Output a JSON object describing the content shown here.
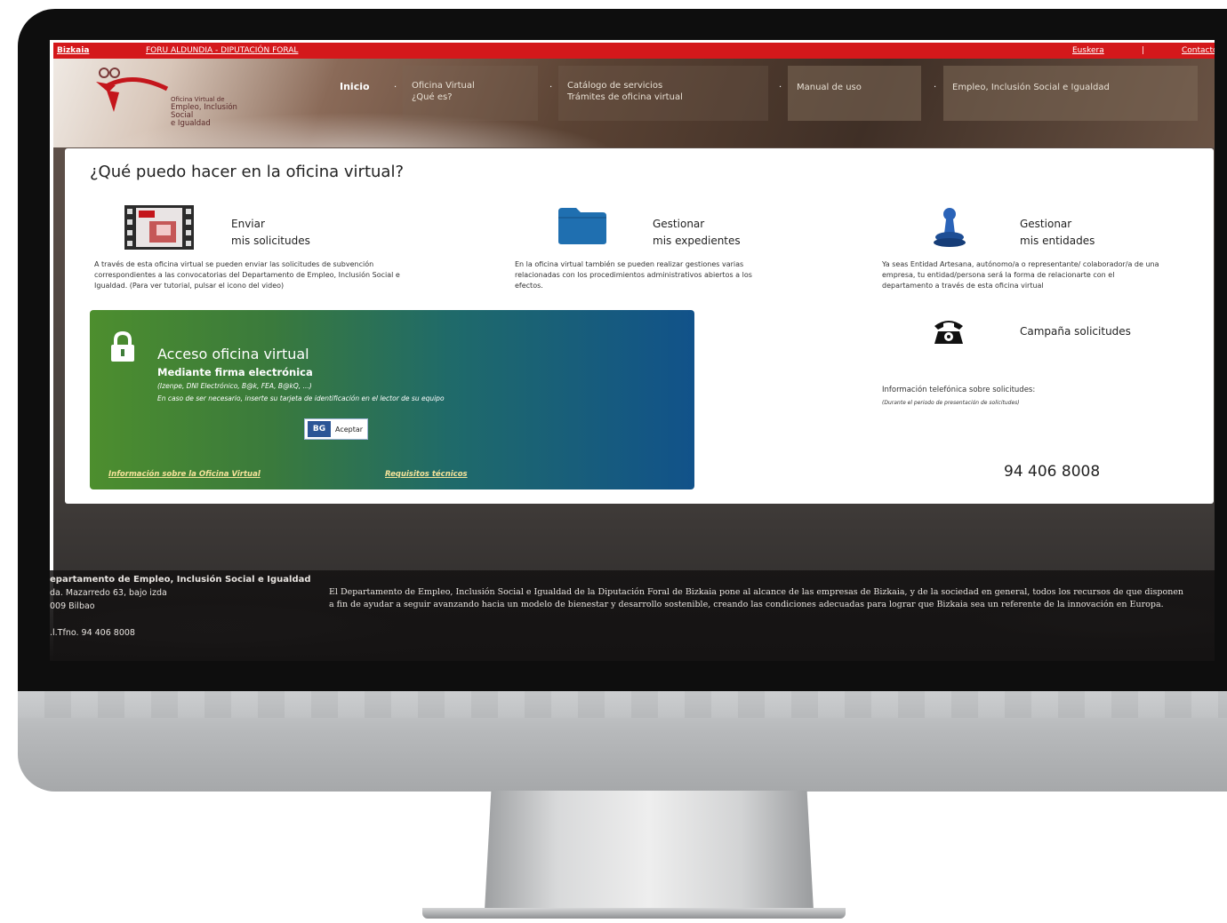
{
  "topbar": {
    "bizkaia": "Bizkaia",
    "foru": "FORU ALDUNDIA - DIPUTACIÓN FORAL",
    "euskera": "Euskera",
    "separator": "|",
    "contact": "Contacto"
  },
  "header": {
    "logo_line1": "Oficina Virtual de",
    "logo_line2": "Empleo, Inclusión Social\ne Igualdad",
    "nav": {
      "inicio": "Inicio",
      "oficina": "Oficina Virtual\n¿Qué es?",
      "catalogo": "Catálogo de servicios\nTrámites de oficina virtual",
      "manual": "Manual de uso",
      "empleo": "Empleo, Inclusión Social e Igualdad"
    }
  },
  "main": {
    "title": "¿Qué puedo hacer en la oficina virtual?",
    "features": [
      {
        "title": "Enviar\nmis solicitudes",
        "description": "A través de esta oficina virtual se pueden enviar las solicitudes de subvención\ncorrespondientes a las convocatorias del Departamento de Empleo, Inclusión Social e\nIgualdad. (Para ver tutorial, pulsar el icono del video)"
      },
      {
        "title": "Gestionar\nmis expedientes",
        "description": "En la oficina virtual también se pueden realizar gestiones varias\nrelacionadas con los procedimientos administrativos abiertos a los\nefectos."
      },
      {
        "title": "Gestionar\nmis entidades",
        "description": "Ya seas Entidad Artesana, autónomo/a o representante/ colaborador/a de una\nempresa, tu entidad/persona será la forma de relacionarte con el\ndepartamento a través de esta oficina virtual"
      }
    ],
    "campaign": {
      "title": "Campaña solicitudes",
      "info": "Información telefónica sobre solicitudes:",
      "note": "(Durante el periodo de presentación de solicitudes)",
      "phone": "94 406 8008"
    },
    "access": {
      "title": "Acceso oficina virtual",
      "subtitle": "Mediante firma electrónica",
      "note1": "(Izenpe, DNI Electrónico, B@k, FEA, B@kQ, ...)",
      "note2": "En caso de ser necesario, inserte su tarjeta de identificación en el lector de su equipo",
      "button_badge": "BG",
      "button_label": "Aceptar",
      "link_info": "Información sobre la Oficina Virtual",
      "link_req": "Requisitos técnicos"
    }
  },
  "footer": {
    "dept": "epartamento de Empleo, Inclusión Social e Igualdad",
    "address": "da. Mazarredo 63, bajo izda\n009 Bilbao",
    "phone": ".l.Tfno. 94 406 8008",
    "text": "El Departamento de Empleo, Inclusión Social e Igualdad de la Diputación Foral de Bizkaia pone al alcance de las empresas de Bizkaia, y de la sociedad en general, todos los recursos de que disponen a fin de ayudar a seguir avanzando hacia un modelo de bienestar y desarrollo sostenible, creando las condiciones adecuadas para lograr que Bizkaia sea un referente de la innovación en Europa."
  },
  "colors": {
    "brand_red": "#d4181b",
    "access_green": "#4d8e2e",
    "access_blue": "#11528a",
    "folder_blue": "#1f6fb0"
  },
  "icons": [
    "video-tutorial-icon",
    "folder-icon",
    "stamp-icon",
    "telephone-icon",
    "lock-icon"
  ]
}
